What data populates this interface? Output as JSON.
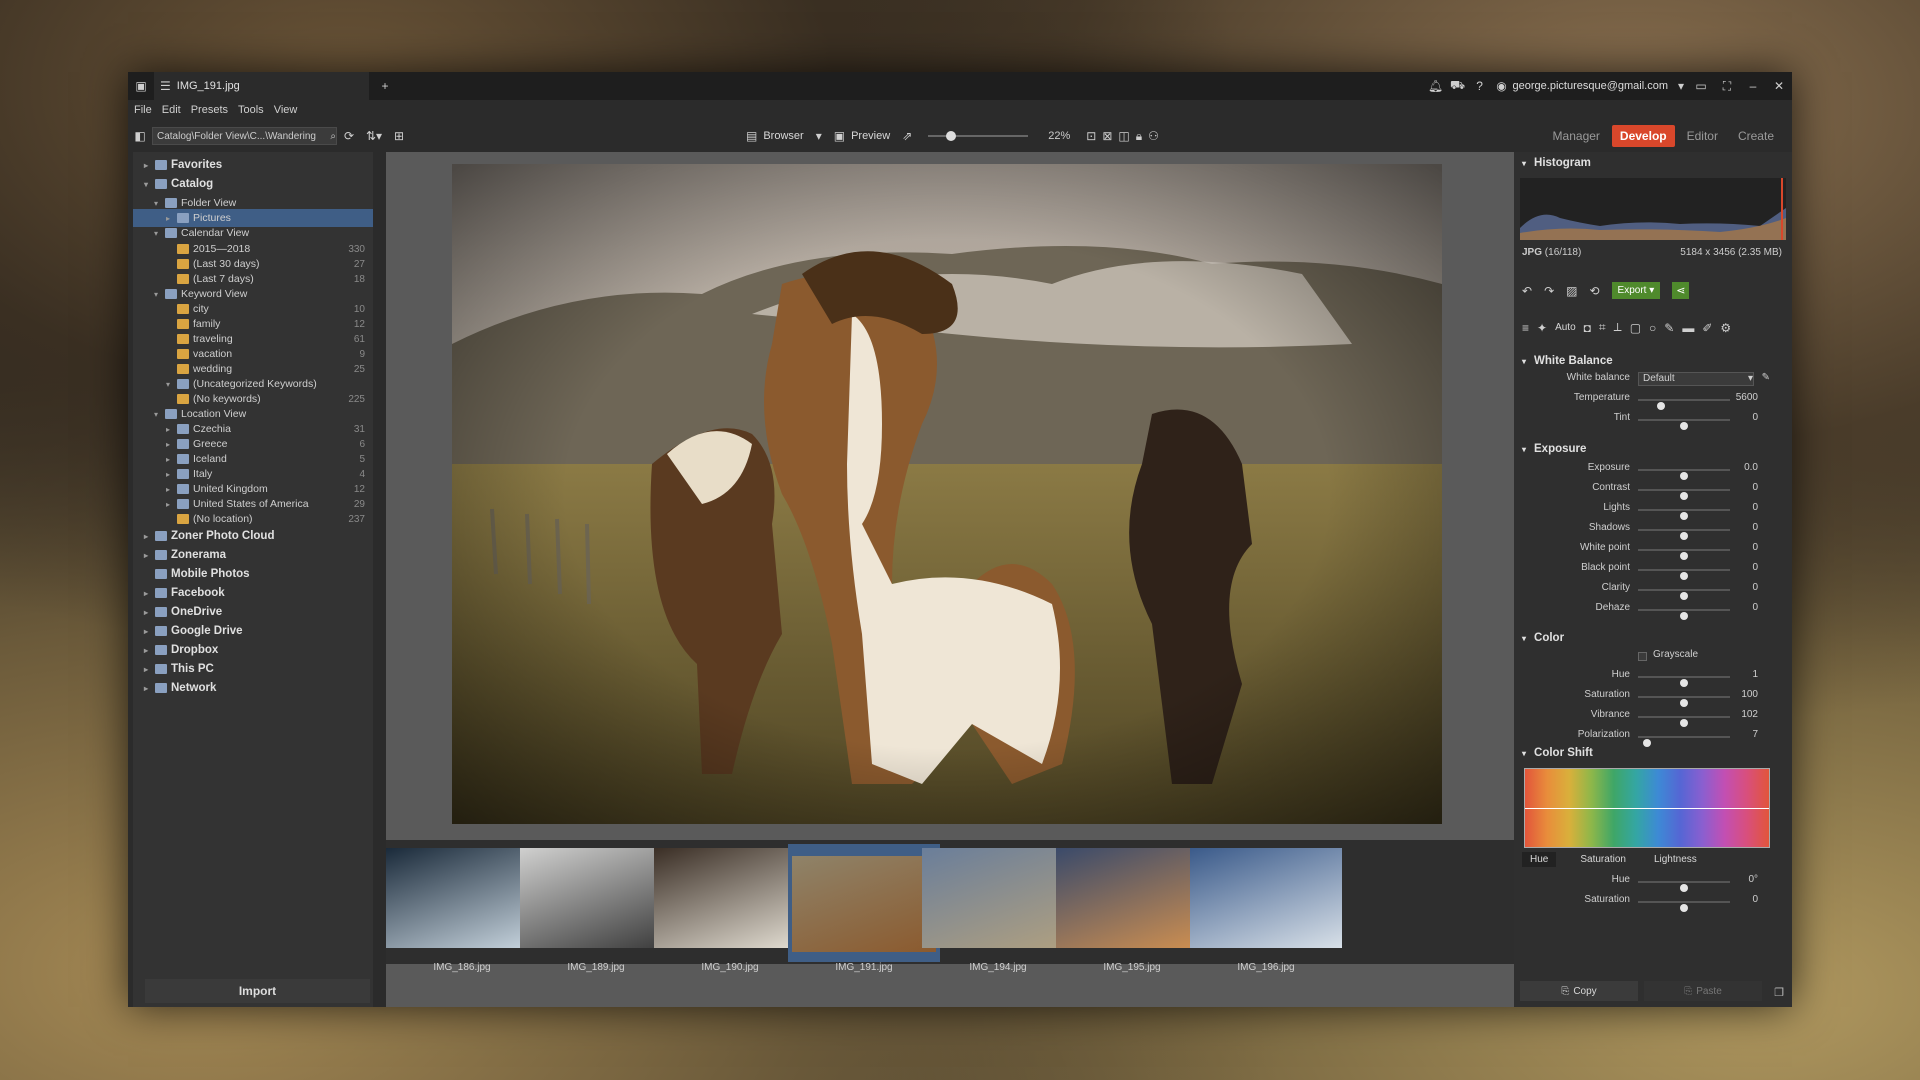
{
  "window": {
    "tab_title": "IMG_191.jpg",
    "user": "george.picturesque@gmail.com"
  },
  "menu": [
    "File",
    "Edit",
    "Presets",
    "Tools",
    "View"
  ],
  "toolbar": {
    "path": "Catalog\\Folder View\\C...\\Wandering",
    "browser": "Browser",
    "preview": "Preview",
    "zoom": "22%"
  },
  "modes": [
    "Manager",
    "Develop",
    "Editor",
    "Create"
  ],
  "tree": [
    {
      "label": "Favorites",
      "bold": true,
      "level": 0,
      "arrow": "▸"
    },
    {
      "label": "Catalog",
      "bold": true,
      "level": 0,
      "arrow": "▾"
    },
    {
      "label": "Folder View",
      "level": 1,
      "arrow": "▾"
    },
    {
      "label": "Pictures",
      "level": 2,
      "arrow": "▸",
      "sel": true
    },
    {
      "label": "Calendar View",
      "level": 1,
      "arrow": "▾"
    },
    {
      "label": "2015—2018",
      "level": 2,
      "count": "330"
    },
    {
      "label": "(Last 30 days)",
      "level": 2,
      "count": "27"
    },
    {
      "label": "(Last 7 days)",
      "level": 2,
      "count": "18"
    },
    {
      "label": "Keyword View",
      "level": 1,
      "arrow": "▾"
    },
    {
      "label": "city",
      "level": 2,
      "count": "10"
    },
    {
      "label": "family",
      "level": 2,
      "count": "12"
    },
    {
      "label": "traveling",
      "level": 2,
      "count": "61"
    },
    {
      "label": "vacation",
      "level": 2,
      "count": "9"
    },
    {
      "label": "wedding",
      "level": 2,
      "count": "25"
    },
    {
      "label": "(Uncategorized Keywords)",
      "level": 2,
      "arrow": "▾"
    },
    {
      "label": "(No keywords)",
      "level": 2,
      "count": "225"
    },
    {
      "label": "Location View",
      "level": 1,
      "arrow": "▾"
    },
    {
      "label": "Czechia",
      "level": 2,
      "arrow": "▸",
      "count": "31"
    },
    {
      "label": "Greece",
      "level": 2,
      "arrow": "▸",
      "count": "6"
    },
    {
      "label": "Iceland",
      "level": 2,
      "arrow": "▸",
      "count": "5"
    },
    {
      "label": "Italy",
      "level": 2,
      "arrow": "▸",
      "count": "4"
    },
    {
      "label": "United Kingdom",
      "level": 2,
      "arrow": "▸",
      "count": "12"
    },
    {
      "label": "United States of America",
      "level": 2,
      "arrow": "▸",
      "count": "29"
    },
    {
      "label": "(No location)",
      "level": 2,
      "count": "237"
    },
    {
      "label": "Zoner Photo Cloud",
      "bold": true,
      "level": 0,
      "arrow": "▸"
    },
    {
      "label": "Zonerama",
      "bold": true,
      "level": 0,
      "arrow": "▸"
    },
    {
      "label": "Mobile Photos",
      "bold": true,
      "level": 0
    },
    {
      "label": "Facebook",
      "bold": true,
      "level": 0,
      "arrow": "▸"
    },
    {
      "label": "OneDrive",
      "bold": true,
      "level": 0,
      "arrow": "▸"
    },
    {
      "label": "Google Drive",
      "bold": true,
      "level": 0,
      "arrow": "▸"
    },
    {
      "label": "Dropbox",
      "bold": true,
      "level": 0,
      "arrow": "▸"
    },
    {
      "label": "This PC",
      "bold": true,
      "level": 0,
      "arrow": "▸"
    },
    {
      "label": "Network",
      "bold": true,
      "level": 0,
      "arrow": "▸"
    }
  ],
  "import_label": "Import",
  "thumbs": [
    "IMG_186.jpg",
    "IMG_189.jpg",
    "IMG_190.jpg",
    "IMG_191.jpg",
    "IMG_194.jpg",
    "IMG_195.jpg",
    "IMG_196.jpg"
  ],
  "histogram": {
    "title": "Histogram",
    "format": "JPG",
    "index": "(16/118)",
    "size": "5184 x 3456 (2.35 MB)"
  },
  "actions": {
    "export": "Export",
    "auto": "Auto"
  },
  "white_balance": {
    "title": "White Balance",
    "label": "White balance",
    "preset": "Default",
    "sliders": [
      {
        "name": "Temperature",
        "value": "5600",
        "pos": 0.25
      },
      {
        "name": "Tint",
        "value": "0",
        "pos": 0.5
      }
    ]
  },
  "exposure": {
    "title": "Exposure",
    "sliders": [
      {
        "name": "Exposure",
        "value": "0.0",
        "pos": 0.5
      },
      {
        "name": "Contrast",
        "value": "0",
        "pos": 0.5
      },
      {
        "name": "Lights",
        "value": "0",
        "pos": 0.5
      },
      {
        "name": "Shadows",
        "value": "0",
        "pos": 0.5
      },
      {
        "name": "White point",
        "value": "0",
        "pos": 0.5
      },
      {
        "name": "Black point",
        "value": "0",
        "pos": 0.5
      },
      {
        "name": "Clarity",
        "value": "0",
        "pos": 0.5
      },
      {
        "name": "Dehaze",
        "value": "0",
        "pos": 0.5
      }
    ]
  },
  "color": {
    "title": "Color",
    "grayscale": "Grayscale",
    "sliders": [
      {
        "name": "Hue",
        "value": "1",
        "pos": 0.5
      },
      {
        "name": "Saturation",
        "value": "100",
        "pos": 0.5
      },
      {
        "name": "Vibrance",
        "value": "102",
        "pos": 0.5
      },
      {
        "name": "Polarization",
        "value": "7",
        "pos": 0.1
      }
    ]
  },
  "color_shift": {
    "title": "Color Shift",
    "tabs": [
      "Hue",
      "Saturation",
      "Lightness"
    ],
    "sliders": [
      {
        "name": "Hue",
        "value": "0°",
        "pos": 0.5
      },
      {
        "name": "Saturation",
        "value": "0",
        "pos": 0.5
      }
    ]
  },
  "copy_label": "Copy",
  "paste_label": "Paste",
  "colors": {
    "accent": "#d9472b",
    "selection": "#3f5e86",
    "export": "#4f8a2c"
  }
}
